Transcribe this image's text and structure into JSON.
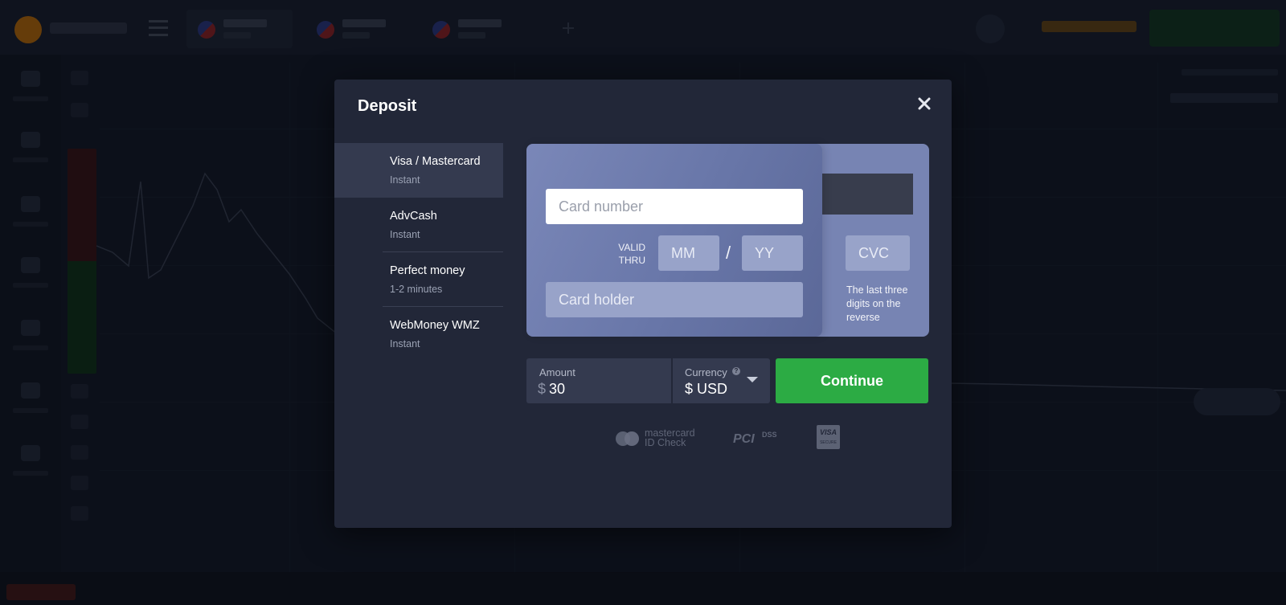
{
  "modal": {
    "title": "Deposit"
  },
  "methods": [
    {
      "name": "Visa / Mastercard",
      "time": "Instant",
      "active": true
    },
    {
      "name": "AdvCash",
      "time": "Instant",
      "active": false
    },
    {
      "name": "Perfect money",
      "time": "1-2 minutes",
      "active": false
    },
    {
      "name": "WebMoney WMZ",
      "time": "Instant",
      "active": false
    }
  ],
  "card_form": {
    "card_number_placeholder": "Card number",
    "valid_thru_line1": "VALID",
    "valid_thru_line2": "THRU",
    "month_placeholder": "MM",
    "separator": "/",
    "year_placeholder": "YY",
    "holder_placeholder": "Card holder",
    "cvc_placeholder": "CVC",
    "cvc_hint": "The last three digits on the reverse"
  },
  "amount": {
    "label": "Amount",
    "currency_symbol": "$",
    "value": "30"
  },
  "currency": {
    "label": "Currency",
    "help_glyph": "?",
    "value": "$ USD"
  },
  "continue_label": "Continue",
  "badges": {
    "mastercard_line1": "mastercard",
    "mastercard_line2": "ID Check",
    "pci_text": "PCI",
    "pci_sub": "DSS",
    "visa_line1": "VISA",
    "visa_line2": "SECURE"
  },
  "colors": {
    "accent_green": "#2cab44",
    "card_blue": "#7784b3",
    "modal_bg": "#222738",
    "active_method_bg": "#343a4f"
  }
}
